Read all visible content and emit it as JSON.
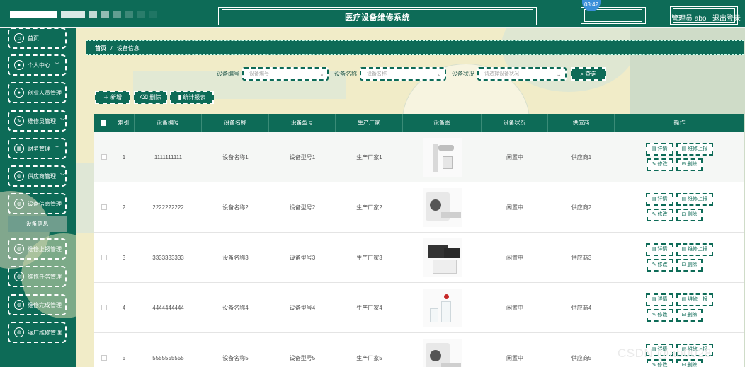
{
  "header": {
    "title": "医疗设备维修系统",
    "clock": "03:42",
    "user_label": "管理员 abo",
    "logout_label": "退出登录"
  },
  "sidebar": {
    "items": [
      {
        "label": "首页",
        "icon": "home-icon"
      },
      {
        "label": "个人中心",
        "icon": "user-icon",
        "chevron": "﹀"
      },
      {
        "label": "创业人员管理",
        "icon": "person-icon"
      },
      {
        "label": "维修员管理",
        "icon": "wrench-icon",
        "chevron": "﹀"
      },
      {
        "label": "财务管理",
        "icon": "grid-icon",
        "chevron": "﹀"
      },
      {
        "label": "供应商管理",
        "icon": "supplier-icon",
        "chevron": "﹀"
      },
      {
        "label": "设备信息管理",
        "icon": "device-icon"
      },
      {
        "label": "维修上报管理",
        "icon": "report-icon"
      },
      {
        "label": "维修任务管理",
        "icon": "task-icon"
      },
      {
        "label": "维修完成管理",
        "icon": "done-icon"
      },
      {
        "label": "返厂维修管理",
        "icon": "return-icon"
      }
    ],
    "active_sub": "设备信息"
  },
  "breadcrumb": {
    "home": "首页",
    "separator": "/",
    "current": "设备信息"
  },
  "search": {
    "code_label": "设备编号",
    "code_placeholder": "设备编号",
    "name_label": "设备名称",
    "name_placeholder": "设备名称",
    "status_label": "设备状况",
    "status_placeholder": "请选择设备状况",
    "button": "查询"
  },
  "actions": {
    "add": "新增",
    "delete": "删除",
    "stats": "统计报表"
  },
  "table": {
    "headers": [
      "",
      "索引",
      "设备编号",
      "设备名称",
      "设备型号",
      "生产厂家",
      "设备图",
      "设备状况",
      "供应商",
      "操作"
    ],
    "rows": [
      {
        "index": "1",
        "code": "1111111111",
        "name": "设备名称1",
        "model": "设备型号1",
        "maker": "生产厂家1",
        "status": "闲置中",
        "supplier": "供应商1"
      },
      {
        "index": "2",
        "code": "2222222222",
        "name": "设备名称2",
        "model": "设备型号2",
        "maker": "生产厂家2",
        "status": "闲置中",
        "supplier": "供应商2"
      },
      {
        "index": "3",
        "code": "3333333333",
        "name": "设备名称3",
        "model": "设备型号3",
        "maker": "生产厂家3",
        "status": "闲置中",
        "supplier": "供应商3"
      },
      {
        "index": "4",
        "code": "4444444444",
        "name": "设备名称4",
        "model": "设备型号4",
        "maker": "生产厂家4",
        "status": "闲置中",
        "supplier": "供应商4"
      },
      {
        "index": "5",
        "code": "5555555555",
        "name": "设备名称5",
        "model": "设备型号5",
        "maker": "生产厂家5",
        "status": "闲置中",
        "supplier": "供应商5"
      }
    ],
    "op_labels": {
      "detail": "详情",
      "report": "维修上报",
      "edit": "修改",
      "delete": "删除"
    }
  },
  "watermark": "CSDN @ab0028",
  "colors": {
    "primary": "#0d6b57",
    "main_bg": "#f1ecc8"
  }
}
